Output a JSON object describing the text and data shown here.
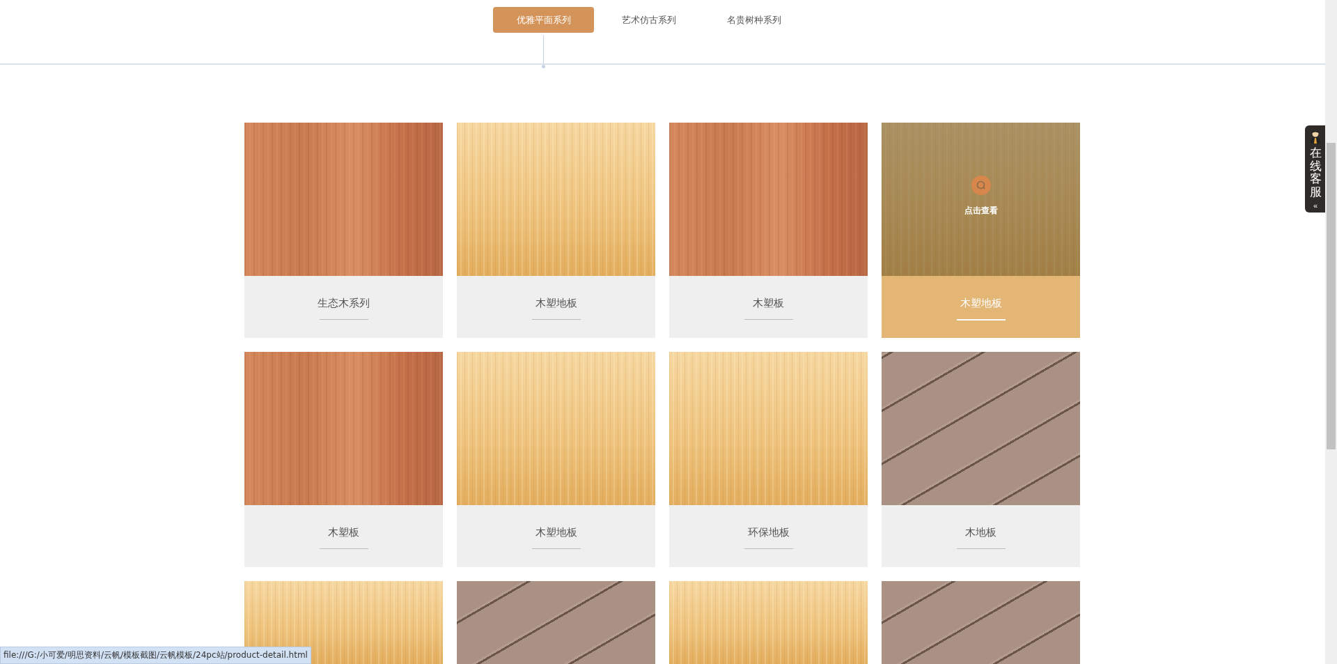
{
  "tabs": [
    {
      "label": "优雅平面系列",
      "selected": true
    },
    {
      "label": "艺术仿古系列",
      "selected": false
    },
    {
      "label": "名贵树种系列",
      "selected": false
    }
  ],
  "hover_label": "点击查看",
  "products": [
    {
      "name": "生态木系列",
      "kind": "cherry",
      "hovered": false
    },
    {
      "name": "木塑地板",
      "kind": "maple",
      "hovered": false
    },
    {
      "name": "木塑板",
      "kind": "cherry",
      "hovered": false
    },
    {
      "name": "木塑地板",
      "kind": "maple",
      "hovered": true
    },
    {
      "name": "木塑板",
      "kind": "cherry",
      "hovered": false
    },
    {
      "name": "木塑地板",
      "kind": "maple",
      "hovered": false
    },
    {
      "name": "环保地板",
      "kind": "maple",
      "hovered": false
    },
    {
      "name": "木地板",
      "kind": "planks",
      "hovered": false
    },
    {
      "kind": "maple",
      "hovered": false
    },
    {
      "kind": "planks",
      "hovered": false
    },
    {
      "kind": "maple",
      "hovered": false
    },
    {
      "kind": "planks",
      "hovered": false
    }
  ],
  "service": {
    "label": "在线客服",
    "collapse": "«"
  },
  "status_bar": "file:///G:/小可爱/明思资料/云帆/模板截图/云帆模板/24pc站/product-detail.html"
}
